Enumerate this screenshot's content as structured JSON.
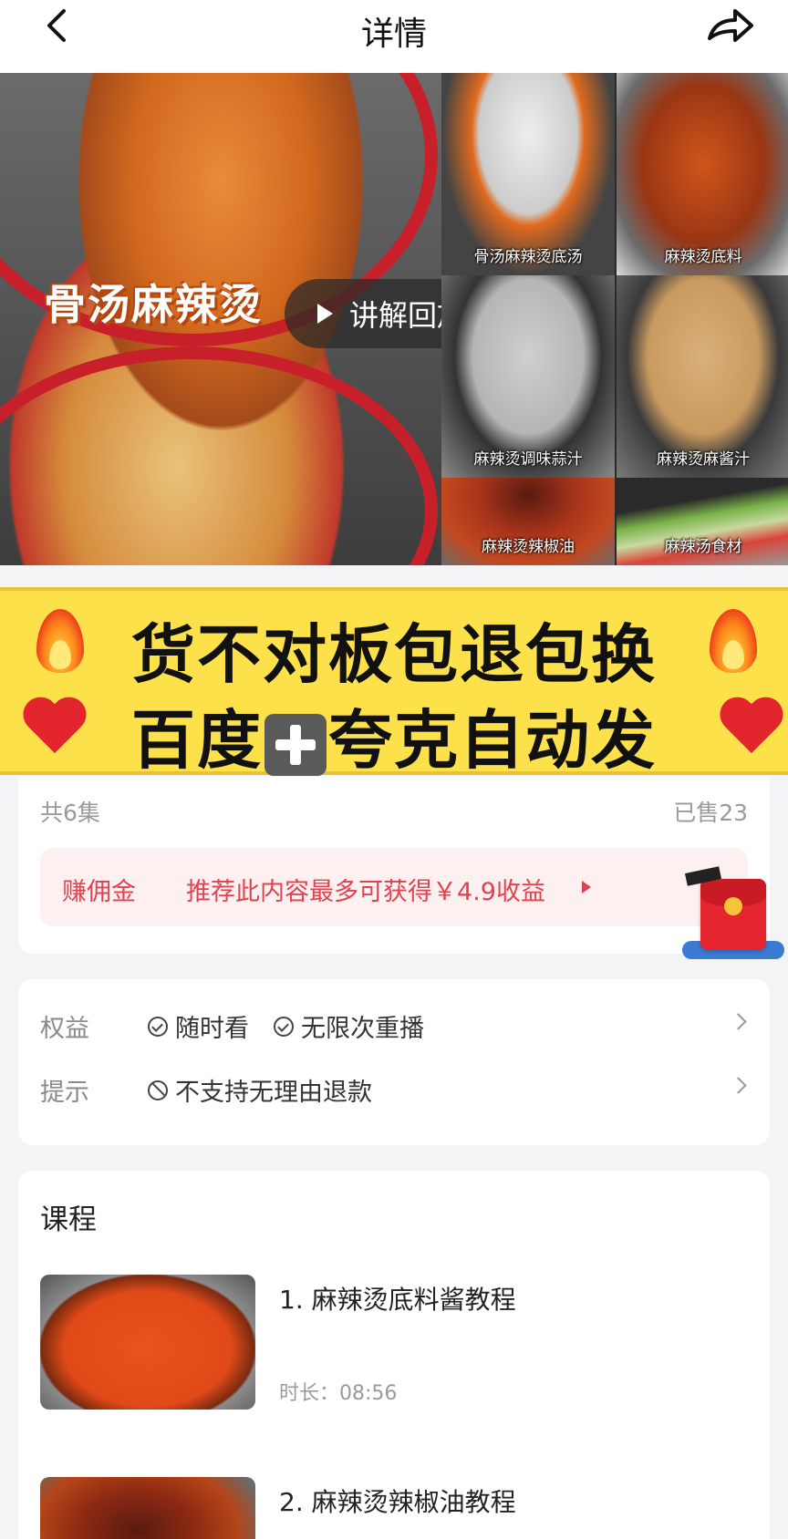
{
  "nav": {
    "title": "详情",
    "back_icon": "chevron-left-icon",
    "share_icon": "share-arrow-icon"
  },
  "hero": {
    "main_label": "骨汤麻辣烫",
    "replay_label": "讲解回放",
    "tiles": [
      {
        "caption": "骨汤麻辣烫底汤"
      },
      {
        "caption": "麻辣烫底料"
      },
      {
        "caption": "麻辣烫调味蒜汁"
      },
      {
        "caption": "麻辣烫麻酱汁"
      },
      {
        "caption": "麻辣烫辣椒油"
      },
      {
        "caption": "麻辣汤食材"
      }
    ]
  },
  "promo": {
    "line1": "货不对板包退包换",
    "line2_a": "百度",
    "line2_b": "夸克自动发",
    "accent": "#fde14a"
  },
  "summary": {
    "episodes": "共6集",
    "sold": "已售23",
    "commission_label": "赚佣金",
    "commission_desc": "推荐此内容最多可获得￥4.9收益"
  },
  "benefits": {
    "benefit_key": "权益",
    "benefit_tags": [
      "随时看",
      "无限次重播"
    ],
    "tip_key": "提示",
    "tip_text": "不支持无理由退款"
  },
  "course": {
    "title": "课程",
    "lessons": [
      {
        "title": "1. 麻辣烫底料酱教程",
        "duration": "时长：08:56"
      },
      {
        "title": "2. 麻辣烫辣椒油教程"
      }
    ]
  }
}
